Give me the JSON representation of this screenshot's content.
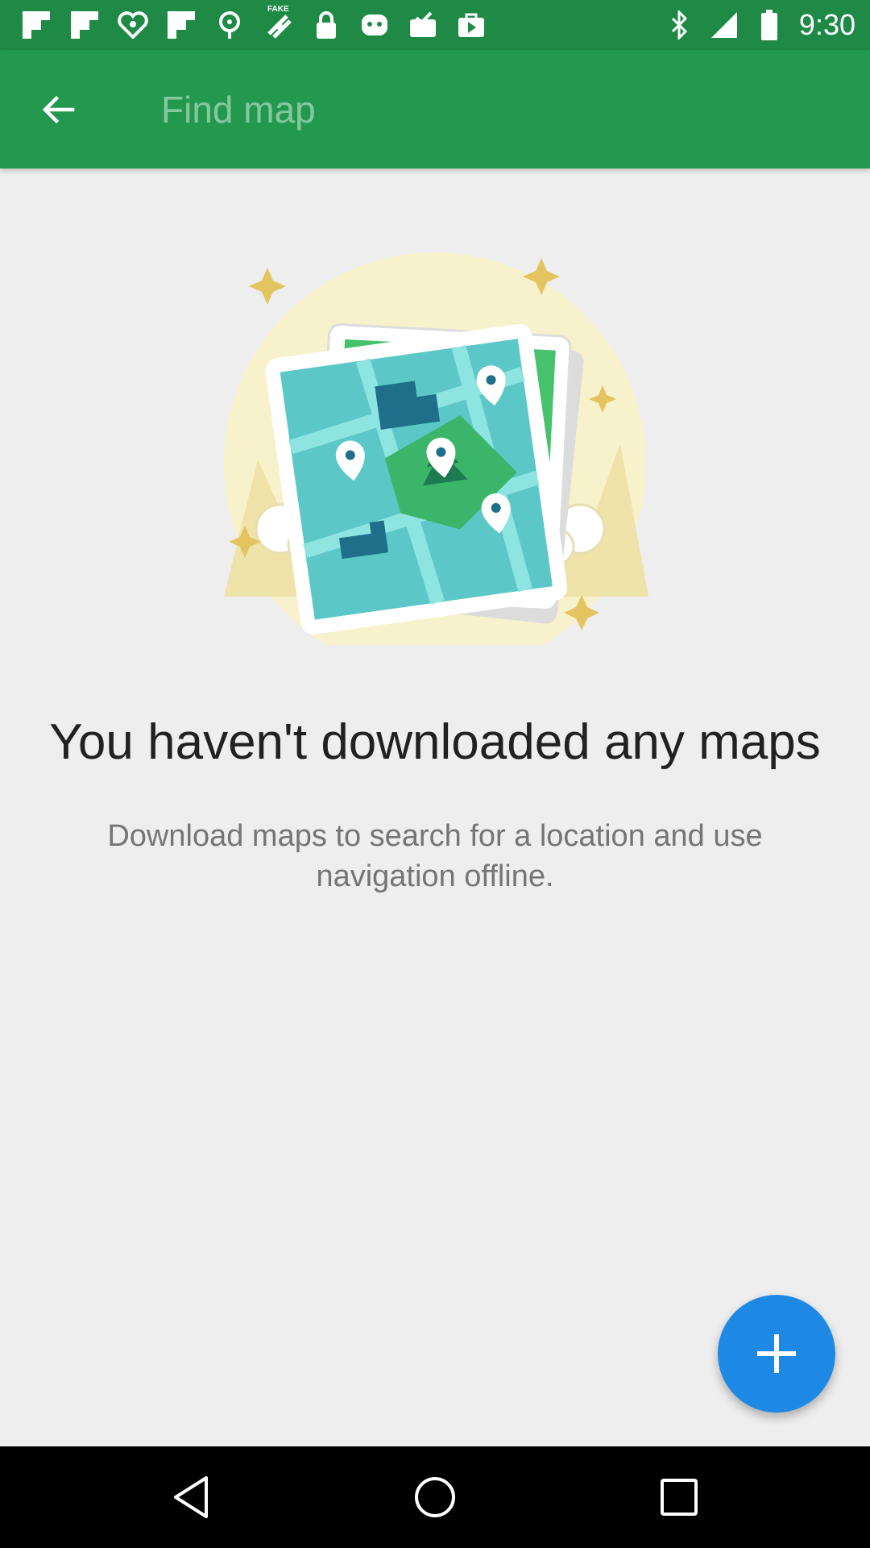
{
  "status_bar": {
    "time": "9:30",
    "icons": [
      "flipboard-icon",
      "flipboard-icon",
      "iheartradio-icon",
      "flipboard-icon",
      "pin-icon",
      "fake-gps-icon",
      "lock-icon",
      "android-icon",
      "inbox-icon",
      "play-store-icon",
      "bluetooth-icon",
      "signal-icon",
      "battery-icon"
    ],
    "fake_label": "FAKE"
  },
  "app_bar": {
    "back_icon": "arrow-back-icon",
    "search_placeholder": "Find map",
    "background": "#23994f"
  },
  "empty_state": {
    "illustration": "folded-maps-illustration",
    "title": "You haven't downloaded any maps",
    "message": "Download maps to search for a location and use navigation offline."
  },
  "fab": {
    "icon": "plus-icon",
    "color": "#1e88e5"
  },
  "nav_bar": {
    "back": "nav-back-icon",
    "home": "nav-home-icon",
    "recents": "nav-recents-icon"
  }
}
